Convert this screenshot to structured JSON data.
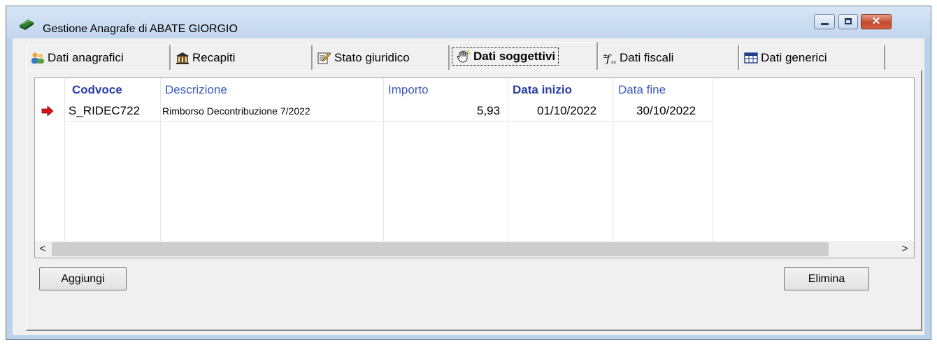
{
  "window": {
    "title": "Gestione Anagrafe di ABATE GIORGIO",
    "close_glyph": "✕"
  },
  "tabs": [
    {
      "label": "Dati anagrafici",
      "icon": "people-icon"
    },
    {
      "label": "Recapiti",
      "icon": "building-icon"
    },
    {
      "label": "Stato giuridico",
      "icon": "edit-document-icon"
    },
    {
      "label": "Dati soggettivi",
      "icon": "hand-icon",
      "active": true
    },
    {
      "label": "Dati fiscali",
      "icon": "function-icon"
    },
    {
      "label": "Dati generici",
      "icon": "table-icon"
    }
  ],
  "grid": {
    "columns": [
      "Codvoce",
      "Descrizione",
      "Importo",
      "Data inizio",
      "Data fine"
    ],
    "rows": [
      {
        "codvoce": "S_RIDEC722",
        "descrizione": "Rimborso Decontribuzione 7/2022",
        "importo": "5,93",
        "data_inizio": "01/10/2022",
        "data_fine": "30/10/2022"
      }
    ]
  },
  "scroll": {
    "left": "<",
    "right": ">"
  },
  "buttons": {
    "add": "Aggiungi",
    "delete": "Elimina"
  },
  "colors": {
    "header_blue": "#2b3fa8",
    "row_arrow": "#d0161b"
  }
}
